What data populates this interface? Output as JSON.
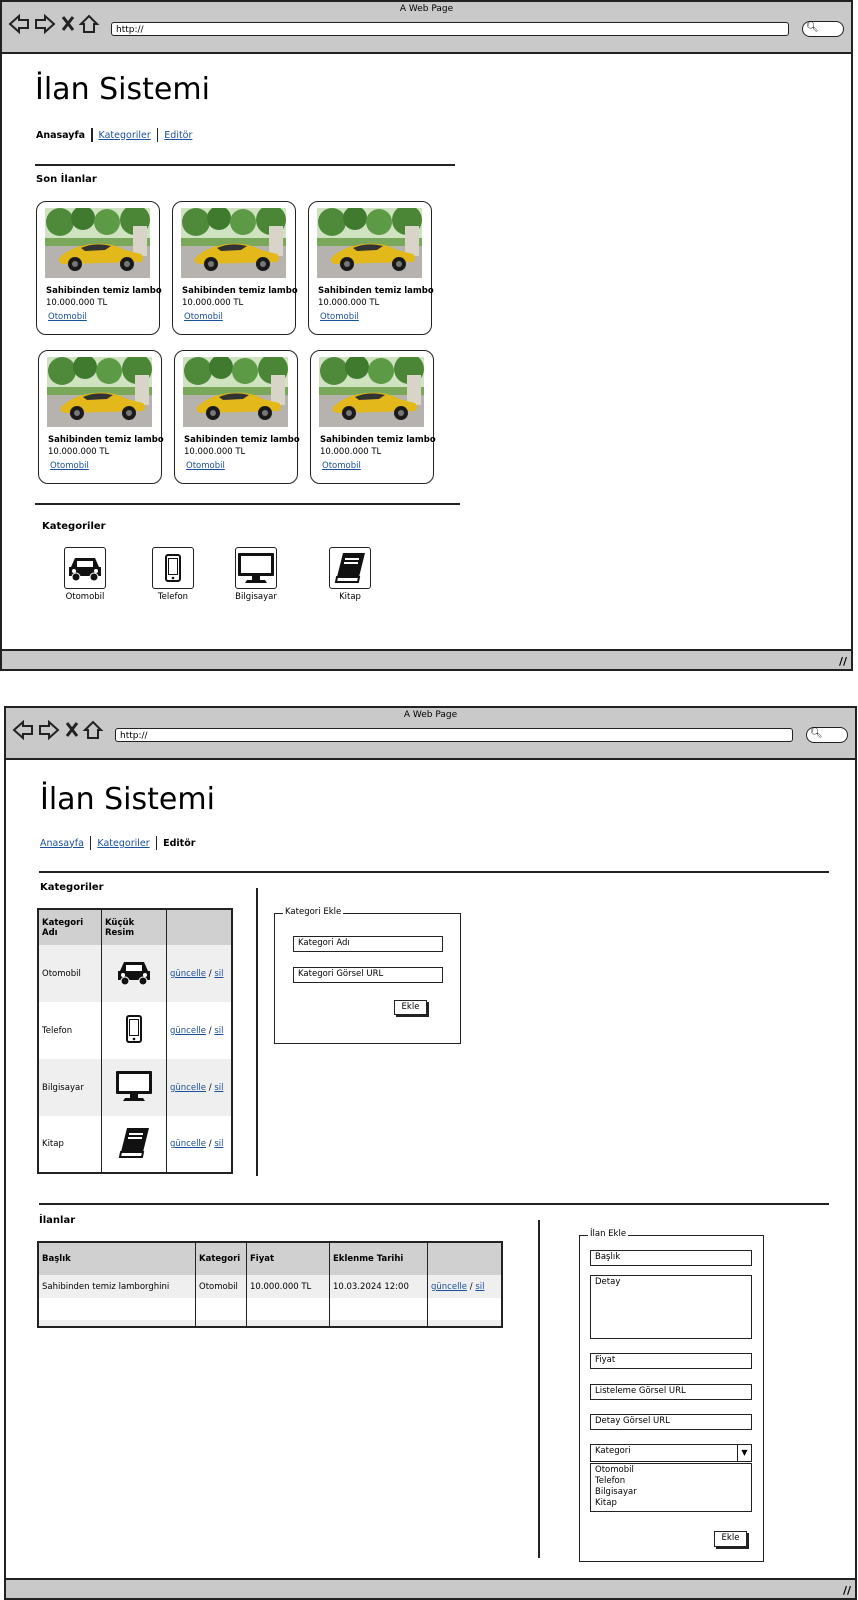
{
  "browser": {
    "window_title": "A Web Page",
    "url": "http://"
  },
  "app": {
    "title": "İlan Sistemi"
  },
  "nav": {
    "home": "Anasayfa",
    "categories": "Kategoriler",
    "editor": "Editör"
  },
  "home": {
    "latest_heading": "Son İlanlar",
    "listings": [
      {
        "title": "Sahibinden temiz lambo",
        "price": "10.000.000 TL",
        "category": "Otomobil"
      },
      {
        "title": "Sahibinden temiz lambo",
        "price": "10.000.000 TL",
        "category": "Otomobil"
      },
      {
        "title": "Sahibinden temiz lambo",
        "price": "10.000.000 TL",
        "category": "Otomobil"
      },
      {
        "title": "Sahibinden temiz lambo",
        "price": "10.000.000 TL",
        "category": "Otomobil"
      },
      {
        "title": "Sahibinden temiz lambo",
        "price": "10.000.000 TL",
        "category": "Otomobil"
      },
      {
        "title": "Sahibinden temiz lambo",
        "price": "10.000.000 TL",
        "category": "Otomobil"
      }
    ],
    "categories_heading": "Kategoriler",
    "categories": [
      {
        "label": "Otomobil",
        "icon": "car-icon"
      },
      {
        "label": "Telefon",
        "icon": "phone-icon"
      },
      {
        "label": "Bilgisayar",
        "icon": "monitor-icon"
      },
      {
        "label": "Kitap",
        "icon": "book-icon"
      }
    ]
  },
  "editor": {
    "categories_heading": "Kategoriler",
    "category_table": {
      "headers": [
        "Kategori Adı",
        "Küçük Resim",
        ""
      ],
      "rows": [
        {
          "name": "Otomobil",
          "icon": "car-icon",
          "update": "güncelle",
          "sep": "/",
          "delete": "sil"
        },
        {
          "name": "Telefon",
          "icon": "phone-icon",
          "update": "güncelle",
          "sep": "/",
          "delete": "sil"
        },
        {
          "name": "Bilgisayar",
          "icon": "monitor-icon",
          "update": "güncelle",
          "sep": "/",
          "delete": "sil"
        },
        {
          "name": "Kitap",
          "icon": "book-icon",
          "update": "güncelle",
          "sep": "/",
          "delete": "sil"
        }
      ]
    },
    "add_category": {
      "legend": "Kategori Ekle",
      "name_placeholder": "Kategori Adı",
      "image_placeholder": "Kategori Görsel URL",
      "submit": "Ekle"
    },
    "listings_heading": "İlanlar",
    "listing_table": {
      "headers": [
        "Başlık",
        "Kategori",
        "Fiyat",
        "Eklenme Tarihi",
        ""
      ],
      "rows": [
        {
          "title": "Sahibinden temiz lamborghini",
          "category": "Otomobil",
          "price": "10.000.000 TL",
          "date": "10.03.2024 12:00",
          "update": "güncelle",
          "sep": "/",
          "delete": "sil"
        }
      ]
    },
    "add_listing": {
      "legend": "İlan Ekle",
      "title_placeholder": "Başlık",
      "detail_placeholder": "Detay",
      "price_placeholder": "Fiyat",
      "list_image_placeholder": "Listeleme Görsel URL",
      "detail_image_placeholder": "Detay Görsel URL",
      "category_select": "Kategori",
      "category_options": [
        "Otomobil",
        "Telefon",
        "Bilgisayar",
        "Kitap"
      ],
      "submit": "Ekle"
    }
  }
}
